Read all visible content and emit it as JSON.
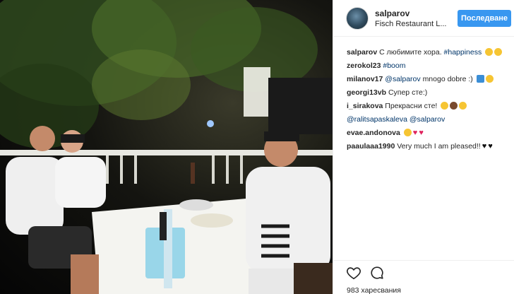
{
  "post": {
    "username": "salparov",
    "location": "Fisch Restaurant L...",
    "follow_label": "Последване",
    "likes": "983 харесвания"
  },
  "comments": [
    {
      "user": "salparov",
      "text": "С любимите хора.",
      "tag": "#happiness",
      "emoji": [
        "smile-emoji",
        "heart-eyes-emoji"
      ]
    },
    {
      "user": "zerokol23",
      "text": "",
      "tag": "#boom",
      "emoji": []
    },
    {
      "user": "milanov17",
      "mention": "@salparov",
      "text": "mnogo dobre :)",
      "emoji": [
        "down-arrow-emoji",
        "clap-emoji"
      ]
    },
    {
      "user": "georgi13vb",
      "text": "Супер сте:)",
      "emoji": []
    },
    {
      "user": "i_sirakova",
      "text": "Прекрасни сте!",
      "emoji": [
        "heart-eyes-emoji",
        "monkey-emoji",
        "hug-emoji"
      ]
    },
    {
      "user": "",
      "mention": "@ralitsapaskaleva",
      "mention2": "@salparov",
      "text": "",
      "emoji": []
    },
    {
      "user": "evae.andonova",
      "text": "",
      "emoji": [
        "heart-eyes-emoji",
        "red-heart-emoji",
        "red-heart-emoji"
      ]
    },
    {
      "user": "paaulaaa1990",
      "text": "Very much I am pleased!!",
      "emoji": [
        "black-heart-emoji",
        "black-heart-emoji"
      ]
    }
  ],
  "icons": {
    "like": "heart-outline-icon",
    "comment": "speech-bubble-icon"
  },
  "colors": {
    "follow_button": "#3897f0",
    "link": "#003569",
    "text": "#262626"
  }
}
